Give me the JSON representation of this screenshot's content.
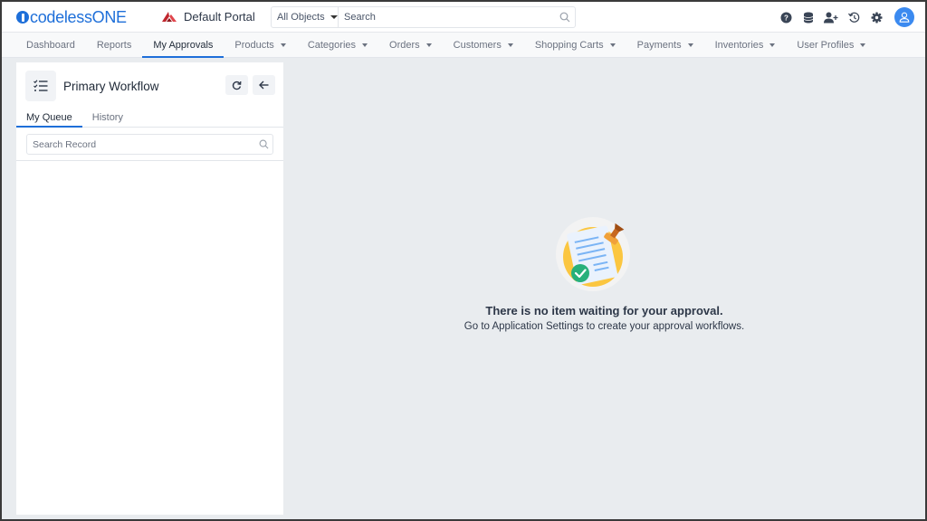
{
  "app": {
    "logo_prefix": "codeless",
    "logo_suffix": "ONE",
    "portal_name": "Default Portal",
    "brand_color": "#1e6fd9"
  },
  "search": {
    "scope_label": "All Objects",
    "placeholder": "Search"
  },
  "header_icons": [
    "help-icon",
    "database-icon",
    "add-user-icon",
    "history-icon",
    "settings-icon",
    "user-avatar-icon"
  ],
  "nav": {
    "items": [
      {
        "label": "Dashboard",
        "dropdown": false
      },
      {
        "label": "Reports",
        "dropdown": false
      },
      {
        "label": "My Approvals",
        "dropdown": false,
        "active": true
      },
      {
        "label": "Products",
        "dropdown": true
      },
      {
        "label": "Categories",
        "dropdown": true
      },
      {
        "label": "Orders",
        "dropdown": true
      },
      {
        "label": "Customers",
        "dropdown": true
      },
      {
        "label": "Shopping Carts",
        "dropdown": true
      },
      {
        "label": "Payments",
        "dropdown": true
      },
      {
        "label": "Inventories",
        "dropdown": true
      },
      {
        "label": "User Profiles",
        "dropdown": true
      }
    ]
  },
  "panel": {
    "title": "Primary Workflow",
    "tabs": [
      {
        "label": "My Queue",
        "active": true
      },
      {
        "label": "History",
        "active": false
      }
    ],
    "search_placeholder": "Search Record"
  },
  "empty_state": {
    "title": "There is no item waiting for your approval.",
    "subtitle": "Go to Application Settings to create your approval workflows."
  }
}
